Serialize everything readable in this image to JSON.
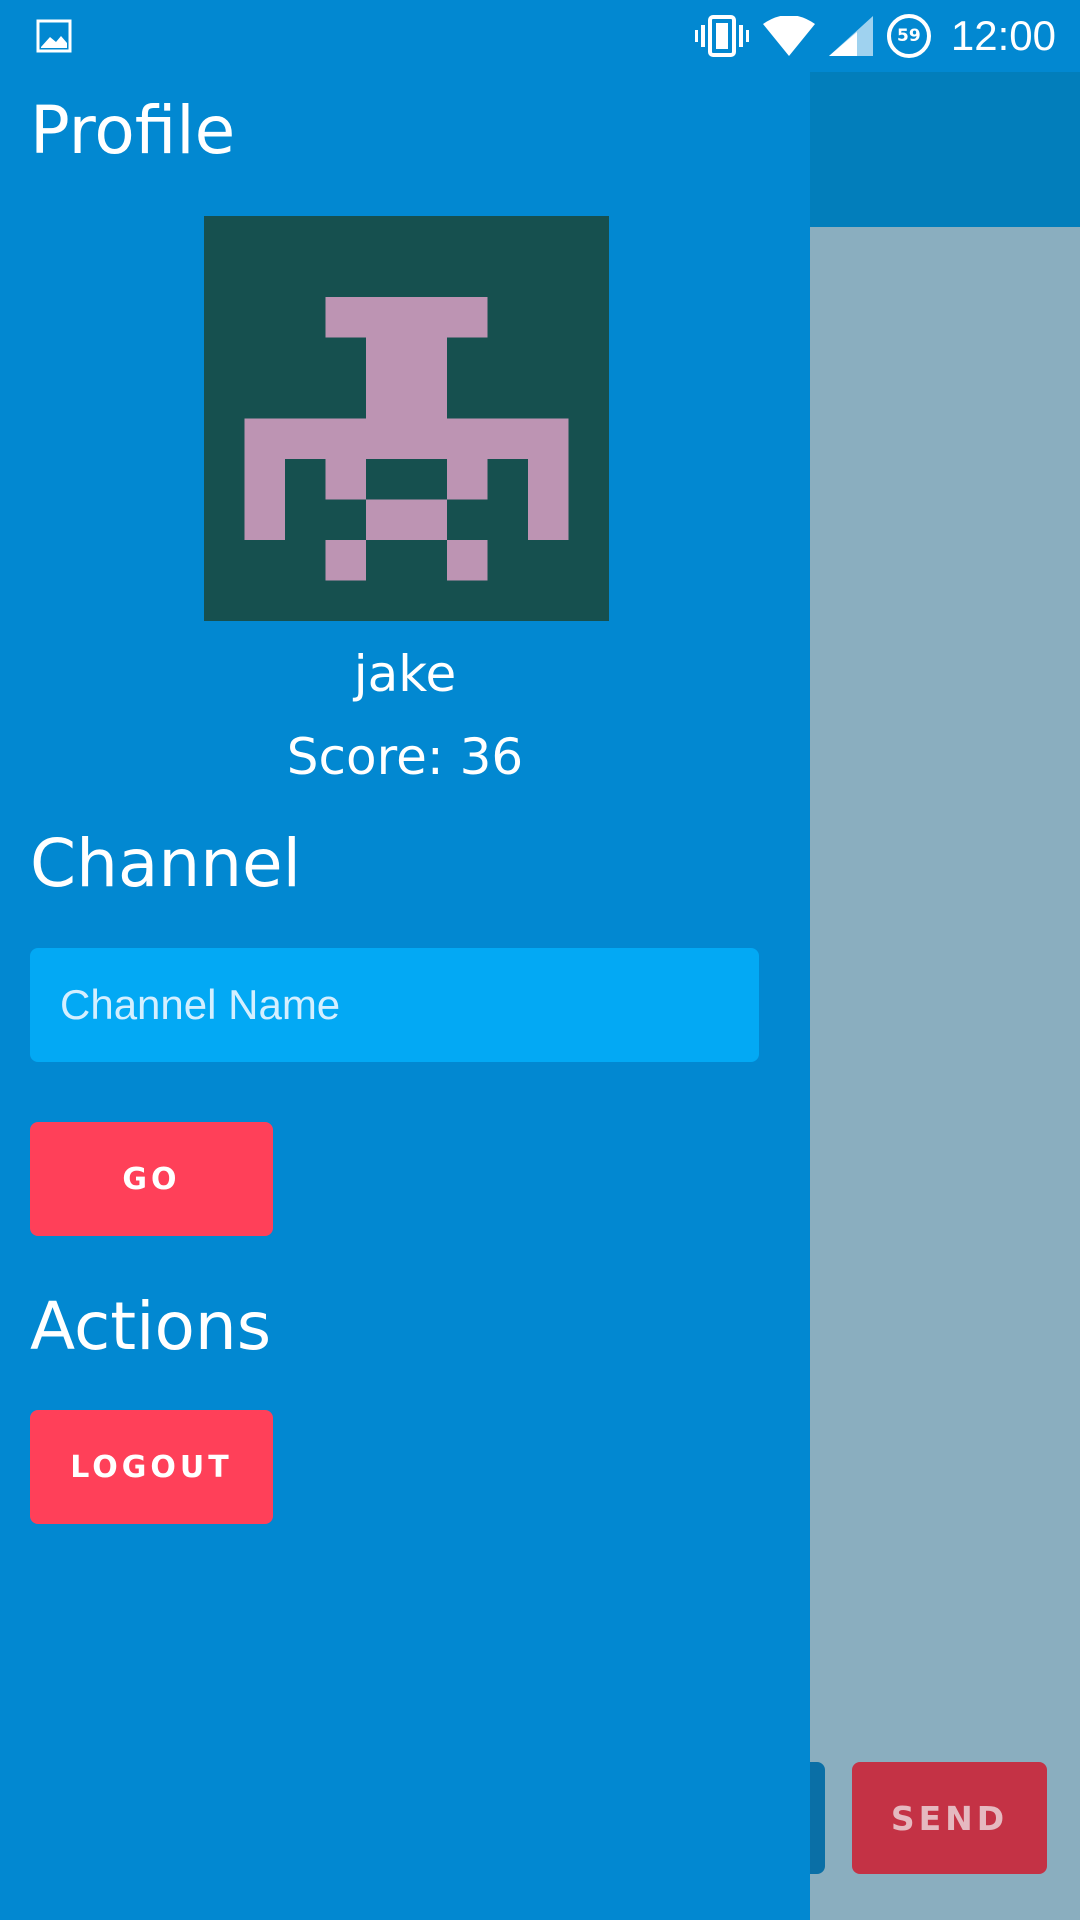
{
  "status_bar": {
    "time": "12:00",
    "battery_level": "59",
    "icons": [
      "image-icon",
      "vibrate-icon",
      "wifi-icon",
      "cell-signal-icon",
      "battery-icon"
    ]
  },
  "drawer": {
    "profile_heading": "Profile",
    "avatar": {
      "icon": "pixel-invader-avatar",
      "background": "#16504f",
      "foreground": "#bd94b3"
    },
    "username": "jake",
    "score": "Score: 36",
    "channel_heading": "Channel",
    "channel_input": {
      "placeholder": "Channel Name",
      "value": ""
    },
    "go_label": "GO",
    "actions_heading": "Actions",
    "logout_label": "LOGOUT"
  },
  "background_app": {
    "send_label": "SEND"
  },
  "colors": {
    "drawer_bg": "#0288d1",
    "toolbar": "#027ebb",
    "content_bg": "#8aaebf",
    "input_bg": "#03a9f4",
    "accent_button": "#ff4059",
    "send_button_dimmed": "#c43245"
  }
}
